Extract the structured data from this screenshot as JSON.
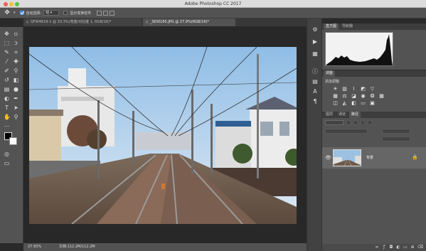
{
  "window": {
    "title": "Adobe Photoshop CC 2017"
  },
  "options_bar": {
    "move_icon": "move-tool-icon",
    "auto_select_label": "自动选择:",
    "auto_select_checked": true,
    "auto_select_target": "组",
    "show_transform_label": "显示变换控件",
    "show_transform_checked": false
  },
  "tabs": [
    {
      "label": "QFW4619-1 @ 33.3%(亮度/对比度 1, RGB/16)*",
      "active": false
    },
    {
      "label": "_SDI0165.JPG @ 27.9%(RGB/16)*",
      "active": true
    }
  ],
  "status": {
    "zoom": "27.93%",
    "doc": "文档:112.2M/112.2M"
  },
  "histogram_panel": {
    "tabs": [
      "直方图",
      "导航器"
    ]
  },
  "adjustments_panel": {
    "tabs": [
      "调整"
    ],
    "subtitle": "添加调整"
  },
  "layers_panel": {
    "tabs": [
      "图层",
      "通道",
      "路径"
    ],
    "layers": [
      {
        "name": "背景"
      }
    ]
  },
  "colors": {
    "accent": "#4a90e2",
    "panel": "#535353",
    "dark": "#282828"
  }
}
